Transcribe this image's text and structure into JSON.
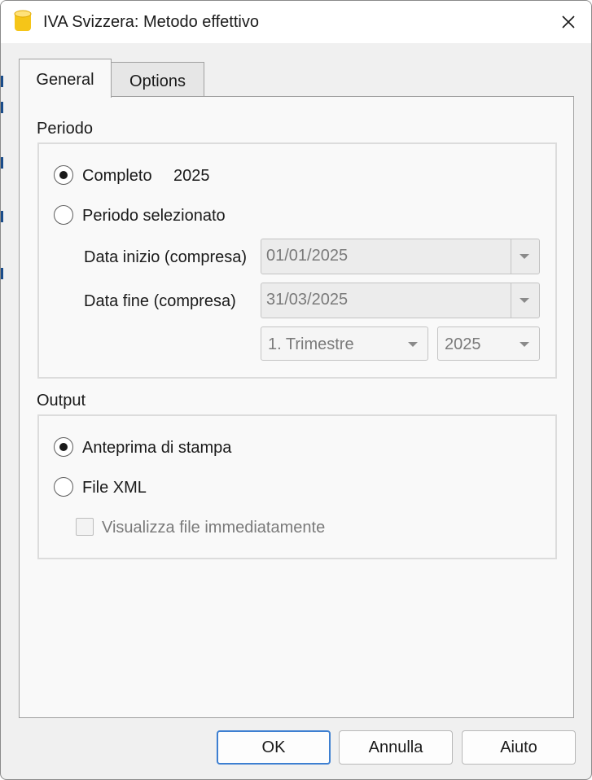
{
  "window": {
    "title": "IVA Svizzera: Metodo effettivo",
    "app_icon": "database-icon",
    "accent_color": "#f5c518"
  },
  "tabs": [
    {
      "label": "General",
      "active": true
    },
    {
      "label": "Options",
      "active": false
    }
  ],
  "periodo": {
    "section_label": "Periodo",
    "completo": {
      "label": "Completo",
      "year": "2025",
      "selected": true
    },
    "selezionato": {
      "label": "Periodo selezionato",
      "selected": false
    },
    "data_inizio": {
      "label": "Data inizio (compresa)",
      "value": "01/01/2025"
    },
    "data_fine": {
      "label": "Data fine (compresa)",
      "value": "31/03/2025"
    },
    "trimestre": {
      "value": "1. Trimestre"
    },
    "anno": {
      "value": "2025"
    }
  },
  "output": {
    "section_label": "Output",
    "anteprima": {
      "label": "Anteprima di stampa",
      "selected": true
    },
    "file_xml": {
      "label": "File XML",
      "selected": false
    },
    "visualizza": {
      "label": "Visualizza file immediatamente",
      "checked": false
    }
  },
  "buttons": {
    "ok": "OK",
    "annulla": "Annulla",
    "aiuto": "Aiuto"
  }
}
